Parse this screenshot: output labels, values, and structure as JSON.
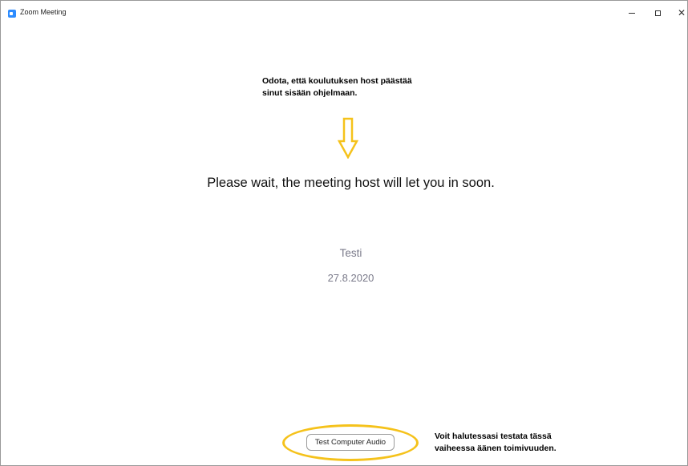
{
  "window": {
    "title": "Zoom Meeting",
    "icon": "zoom-app-icon"
  },
  "annotations": {
    "top_line1": "Odota, että koulutuksen host päästää",
    "top_line2": "sinut sisään ohjelmaan.",
    "bottom_line1": "Voit halutessasi testata tässä",
    "bottom_line2": "vaiheessa äänen toimivuuden.",
    "color": "#f5c21b"
  },
  "main": {
    "wait_message": "Please wait, the meeting host will let you in soon.",
    "meeting_name": "Testi",
    "meeting_date": "27.8.2020"
  },
  "actions": {
    "test_audio_label": "Test Computer Audio"
  }
}
